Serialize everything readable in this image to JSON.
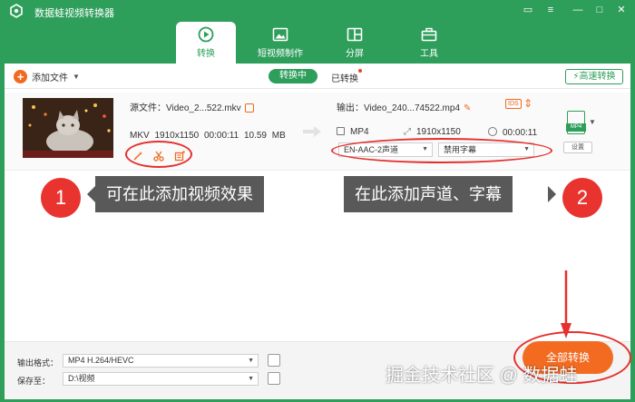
{
  "app": {
    "title": "数据蛙视频转换器"
  },
  "tabs": [
    {
      "label": "转换",
      "icon": "convert-icon",
      "active": true
    },
    {
      "label": "短视频制作",
      "icon": "short-video-icon",
      "active": false
    },
    {
      "label": "分屏",
      "icon": "split-screen-icon",
      "active": false
    },
    {
      "label": "工具",
      "icon": "toolbox-icon",
      "active": false
    }
  ],
  "toolbar": {
    "add_file_label": "添加文件",
    "converting_label": "转换中",
    "converted_label": "已转换",
    "high_speed_label": "高速转换"
  },
  "file": {
    "source_name": "源文件：Video_2...522.mkv",
    "source_format": "MKV",
    "source_resolution": "1910x1150",
    "source_duration": "00:00:11",
    "source_size": "10.59 MB",
    "output_name": "输出：Video_240...74522.mp4",
    "output_format": "MP4",
    "output_resolution": "1910x1150",
    "output_duration": "00:00:11",
    "audio_track": "EN-AAC-2声道",
    "subtitle": "禁用字幕",
    "format_tag": "MP4",
    "settings_label": "设置",
    "ids_badge": "IDS"
  },
  "callouts": {
    "left_number": "1",
    "left_text": "可在此添加视频效果",
    "right_number": "2",
    "right_text": "在此添加声道、字幕"
  },
  "bottom": {
    "output_format_label": "输出格式：",
    "output_format_value": "MP4 H.264/HEVC",
    "save_to_label": "保存至：",
    "save_to_value": "D:\\视频",
    "convert_all_label": "全部转换"
  },
  "watermark": "掘金技术社区 @ 数据蛙",
  "colors": {
    "brand_green": "#2e9e5b",
    "accent_orange": "#f26b21",
    "annotation_red": "#e5302d"
  }
}
